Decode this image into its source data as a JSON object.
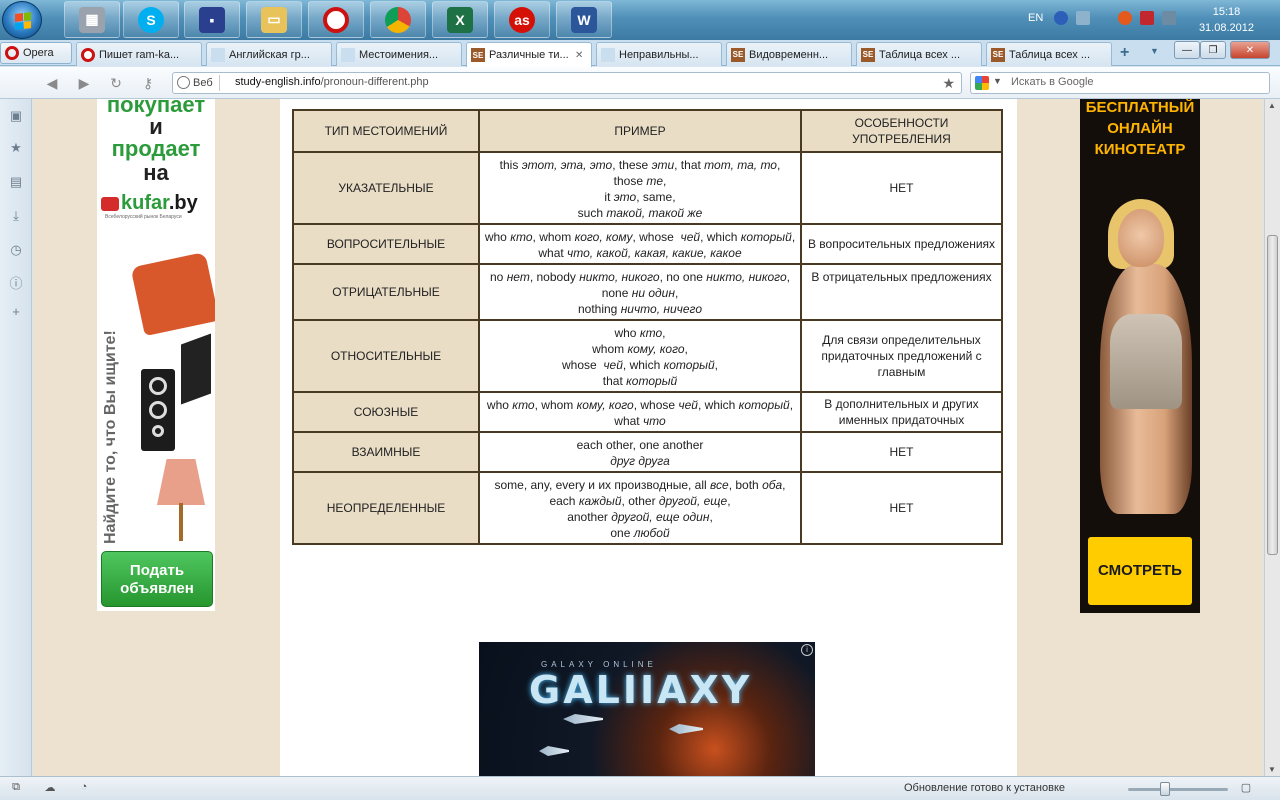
{
  "taskbar": {
    "language": "EN",
    "time": "15:18",
    "date": "31.08.2012"
  },
  "browser": {
    "menu_label": "Opera",
    "tabs": [
      {
        "label": "Пишет ram-ka..."
      },
      {
        "label": "Английская гр..."
      },
      {
        "label": "Местоимения..."
      },
      {
        "label": "Различные ти..."
      },
      {
        "label": "Неправильны..."
      },
      {
        "label": "Видовременн..."
      },
      {
        "label": "Таблица всех ..."
      },
      {
        "label": "Таблица всех ..."
      }
    ],
    "address_badge": "Веб",
    "url_host": "study-english.info",
    "url_path": "/pronoun-different.php",
    "search_placeholder": "Искать в Google",
    "status_message": "Обновление готово к установке"
  },
  "ad_left": {
    "line1": "покупает",
    "line2": "и",
    "line3": "продает",
    "line4": "на",
    "brand_prefix": "kufar",
    "brand_suffix": ".by",
    "slogan": "Всебелорусский рынок Беларуси",
    "vertical_text": "Найдите то, что Вы ищите!",
    "button": "Подать объявлен"
  },
  "ad_right": {
    "header": "БЕСПЛАТНЫЙ ОНЛАЙН КИНОТЕАТР",
    "button": "СМОТРЕТЬ"
  },
  "table": {
    "headers": [
      "ТИП МЕСТОИМЕНИЙ",
      "ПРИМЕР",
      "ОСОБЕННОСТИ УПОТРЕБЛЕНИЯ"
    ],
    "rows": [
      {
        "type": "УКАЗАТЕЛЬНЫЕ",
        "example_html": "this <i>этот, эта, это</i>, these <i>эти</i>, that <i>тот, та, то</i>,<br>those <i>те</i>,<br>it <i>это</i>, same,<br>such <i>такой, такой же</i>",
        "note": "НЕТ",
        "note_top": false
      },
      {
        "type": "ВОПРОСИТЕЛЬНЫЕ",
        "example_html": "who <i>кто</i>, whom <i>кого, кому</i>, whose &nbsp;<i>чей</i>, which <i>который</i>, what <i>что, какой, какая, какие, какое</i>",
        "note": "В вопросительных предложениях",
        "note_top": false
      },
      {
        "type": "ОТРИЦАТЕЛЬНЫЕ",
        "example_html": "no <i>нет</i>, nobody <i>никто, никого</i>, no one <i>никто, никого</i>,<br>none <i>ни один</i>,<br>nothing <i>ничто, ничего</i>",
        "note": "В отрицательных предложениях",
        "note_top": true
      },
      {
        "type": "ОТНОСИТЕЛЬНЫЕ",
        "example_html": "who <i>кто</i>,<br>whom <i>кому, кого</i>,<br>whose &nbsp;<i>чей</i>, which <i>который</i>,<br>that <i>который</i>",
        "note": "Для связи определительных придаточных предложений с главным",
        "note_top": false
      },
      {
        "type": "СОЮЗНЫЕ",
        "example_html": "who <i>кто</i>, whom <i>кому, кого</i>, whose <i>чей</i>, which <i>который</i>,<br>what <i>что</i>",
        "note": "В дополнительных и других именных придаточных",
        "note_top": false
      },
      {
        "type": "ВЗАИМНЫЕ",
        "example_html": "each other, one another<br><i>друг друга</i>",
        "note": "НЕТ",
        "note_top": false
      },
      {
        "type": "НЕОПРЕДЕЛЕННЫЕ",
        "example_html": "some, any, every и их производные, all <i>все</i>, both <i>оба</i>,<br>each <i>каждый</i>, other <i>другой, еще</i>,<br>another <i>другой, еще один</i>,<br>one <i>любой</i>",
        "note": "НЕТ",
        "note_top": false
      }
    ]
  },
  "galaxy_ad": {
    "subtitle": "GALAXY ONLINE",
    "logo": "GALIIAXY",
    "info_icon": "i"
  }
}
